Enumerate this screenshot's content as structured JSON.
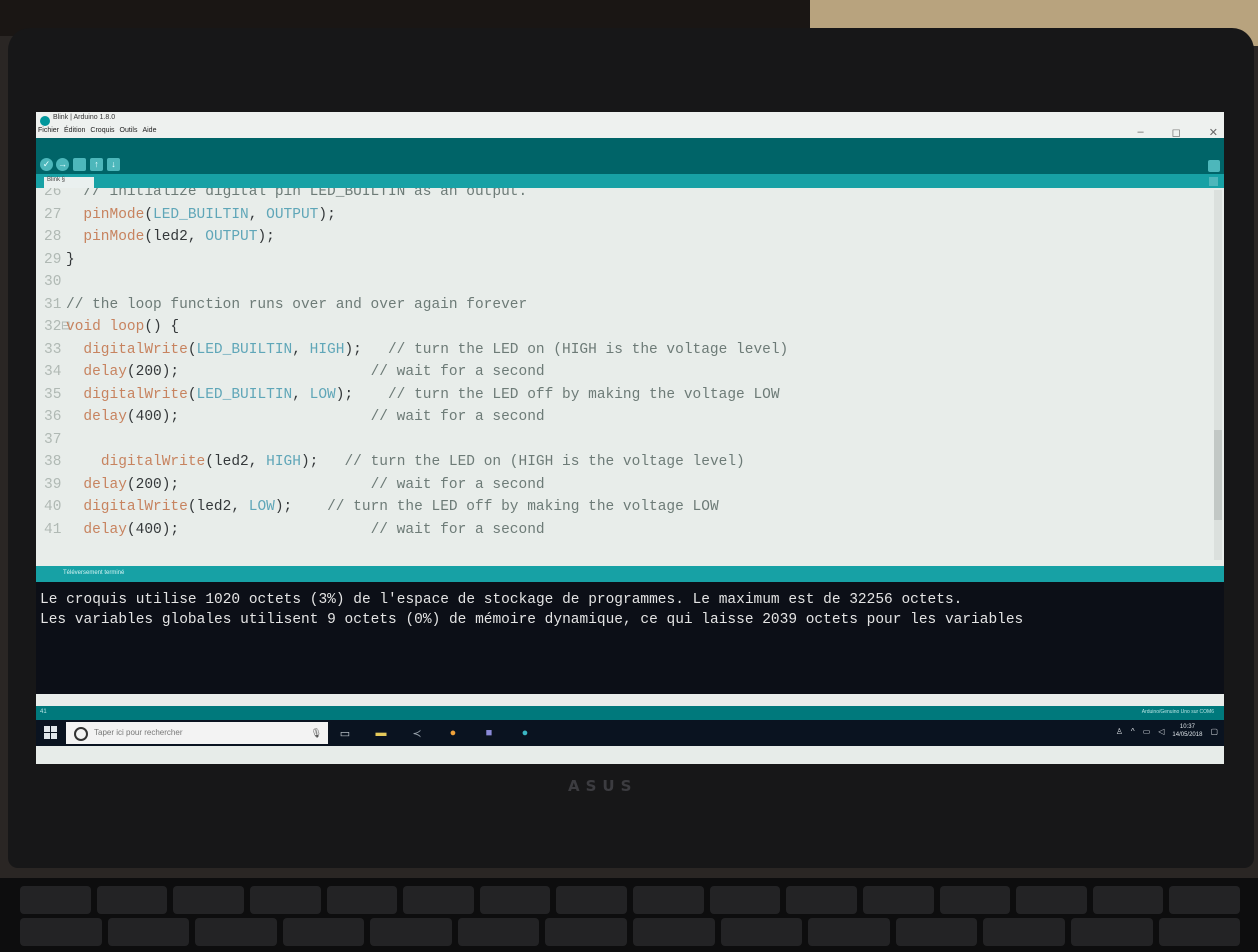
{
  "window": {
    "title": "Blink | Arduino 1.8.0",
    "menu": [
      "Fichier",
      "Édition",
      "Croquis",
      "Outils",
      "Aide"
    ],
    "controls": [
      "–",
      "◻",
      "✕"
    ]
  },
  "toolbar": {
    "buttons": [
      {
        "name": "verify",
        "glyph": "✓"
      },
      {
        "name": "upload",
        "glyph": "→"
      },
      {
        "name": "new",
        "glyph": ""
      },
      {
        "name": "open",
        "glyph": "↑"
      },
      {
        "name": "save",
        "glyph": "↓"
      }
    ]
  },
  "tab": {
    "label": "Blink §"
  },
  "editor": {
    "lines": [
      {
        "n": "26",
        "text": "  // initialize digital pin LED_BUILTIN as an output."
      },
      {
        "n": "27",
        "text": "  pinMode(LED_BUILTIN, OUTPUT);"
      },
      {
        "n": "28",
        "text": "  pinMode(led2, OUTPUT);"
      },
      {
        "n": "29",
        "text": "}"
      },
      {
        "n": "30",
        "text": ""
      },
      {
        "n": "31",
        "text": "// the loop function runs over and over again forever"
      },
      {
        "n": "32⊟",
        "text": "void loop() {"
      },
      {
        "n": "33",
        "text": "  digitalWrite(LED_BUILTIN, HIGH);   // turn the LED on (HIGH is the voltage level)"
      },
      {
        "n": "34",
        "text": "  delay(200);                      // wait for a second"
      },
      {
        "n": "35",
        "text": "  digitalWrite(LED_BUILTIN, LOW);    // turn the LED off by making the voltage LOW"
      },
      {
        "n": "36",
        "text": "  delay(400);                      // wait for a second"
      },
      {
        "n": "37",
        "text": ""
      },
      {
        "n": "38",
        "text": "    digitalWrite(led2, HIGH);   // turn the LED on (HIGH is the voltage level)"
      },
      {
        "n": "39",
        "text": "  delay(200);                      // wait for a second"
      },
      {
        "n": "40",
        "text": "  digitalWrite(led2, LOW);    // turn the LED off by making the voltage LOW"
      },
      {
        "n": "41",
        "text": "  delay(400);                      // wait for a second"
      }
    ]
  },
  "status": {
    "message": "Téléversement terminé"
  },
  "console": {
    "lines": [
      "Le croquis utilise 1020 octets (3%) de l'espace de stockage de programmes. Le maximum est de 32256 octets.",
      "Les variables globales utilisent 9 octets (0%) de mémoire dynamique, ce qui laisse 2039 octets pour les variables"
    ]
  },
  "footer": {
    "line": "41",
    "board": "Arduino/Genuino Uno sur COM6"
  },
  "taskbar": {
    "search_placeholder": "Taper ici pour rechercher",
    "time": "10:37",
    "date": "14/05/2018"
  },
  "colors": {
    "toolbar": "#006468",
    "tabbar": "#17a1a5",
    "console_bg": "#0c0f17",
    "editor_bg": "#e8edea"
  },
  "device": {
    "brand": "ASUS"
  }
}
